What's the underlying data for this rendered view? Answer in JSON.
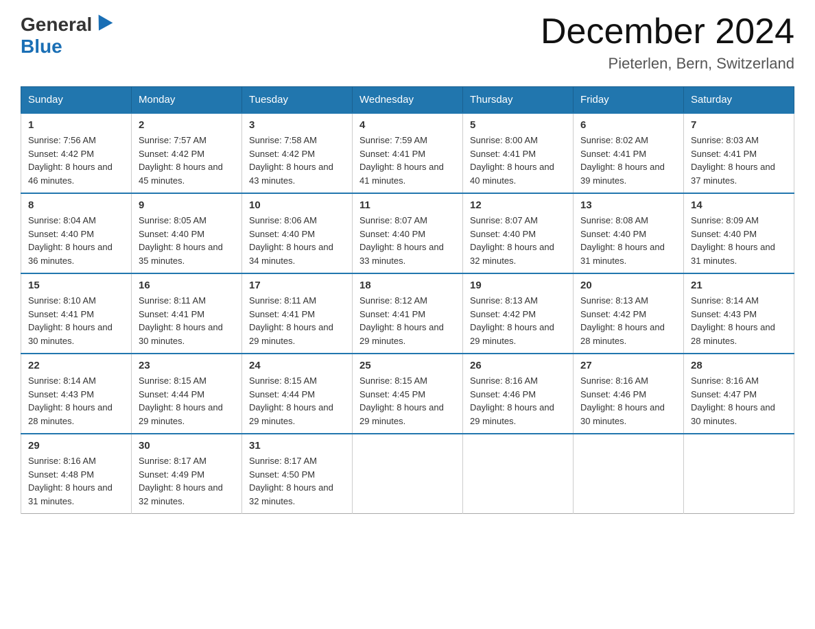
{
  "header": {
    "logo_general": "General",
    "logo_blue": "Blue",
    "month_title": "December 2024",
    "location": "Pieterlen, Bern, Switzerland"
  },
  "weekdays": [
    "Sunday",
    "Monday",
    "Tuesday",
    "Wednesday",
    "Thursday",
    "Friday",
    "Saturday"
  ],
  "weeks": [
    [
      {
        "day": "1",
        "sunrise": "7:56 AM",
        "sunset": "4:42 PM",
        "daylight": "8 hours and 46 minutes."
      },
      {
        "day": "2",
        "sunrise": "7:57 AM",
        "sunset": "4:42 PM",
        "daylight": "8 hours and 45 minutes."
      },
      {
        "day": "3",
        "sunrise": "7:58 AM",
        "sunset": "4:42 PM",
        "daylight": "8 hours and 43 minutes."
      },
      {
        "day": "4",
        "sunrise": "7:59 AM",
        "sunset": "4:41 PM",
        "daylight": "8 hours and 41 minutes."
      },
      {
        "day": "5",
        "sunrise": "8:00 AM",
        "sunset": "4:41 PM",
        "daylight": "8 hours and 40 minutes."
      },
      {
        "day": "6",
        "sunrise": "8:02 AM",
        "sunset": "4:41 PM",
        "daylight": "8 hours and 39 minutes."
      },
      {
        "day": "7",
        "sunrise": "8:03 AM",
        "sunset": "4:41 PM",
        "daylight": "8 hours and 37 minutes."
      }
    ],
    [
      {
        "day": "8",
        "sunrise": "8:04 AM",
        "sunset": "4:40 PM",
        "daylight": "8 hours and 36 minutes."
      },
      {
        "day": "9",
        "sunrise": "8:05 AM",
        "sunset": "4:40 PM",
        "daylight": "8 hours and 35 minutes."
      },
      {
        "day": "10",
        "sunrise": "8:06 AM",
        "sunset": "4:40 PM",
        "daylight": "8 hours and 34 minutes."
      },
      {
        "day": "11",
        "sunrise": "8:07 AM",
        "sunset": "4:40 PM",
        "daylight": "8 hours and 33 minutes."
      },
      {
        "day": "12",
        "sunrise": "8:07 AM",
        "sunset": "4:40 PM",
        "daylight": "8 hours and 32 minutes."
      },
      {
        "day": "13",
        "sunrise": "8:08 AM",
        "sunset": "4:40 PM",
        "daylight": "8 hours and 31 minutes."
      },
      {
        "day": "14",
        "sunrise": "8:09 AM",
        "sunset": "4:40 PM",
        "daylight": "8 hours and 31 minutes."
      }
    ],
    [
      {
        "day": "15",
        "sunrise": "8:10 AM",
        "sunset": "4:41 PM",
        "daylight": "8 hours and 30 minutes."
      },
      {
        "day": "16",
        "sunrise": "8:11 AM",
        "sunset": "4:41 PM",
        "daylight": "8 hours and 30 minutes."
      },
      {
        "day": "17",
        "sunrise": "8:11 AM",
        "sunset": "4:41 PM",
        "daylight": "8 hours and 29 minutes."
      },
      {
        "day": "18",
        "sunrise": "8:12 AM",
        "sunset": "4:41 PM",
        "daylight": "8 hours and 29 minutes."
      },
      {
        "day": "19",
        "sunrise": "8:13 AM",
        "sunset": "4:42 PM",
        "daylight": "8 hours and 29 minutes."
      },
      {
        "day": "20",
        "sunrise": "8:13 AM",
        "sunset": "4:42 PM",
        "daylight": "8 hours and 28 minutes."
      },
      {
        "day": "21",
        "sunrise": "8:14 AM",
        "sunset": "4:43 PM",
        "daylight": "8 hours and 28 minutes."
      }
    ],
    [
      {
        "day": "22",
        "sunrise": "8:14 AM",
        "sunset": "4:43 PM",
        "daylight": "8 hours and 28 minutes."
      },
      {
        "day": "23",
        "sunrise": "8:15 AM",
        "sunset": "4:44 PM",
        "daylight": "8 hours and 29 minutes."
      },
      {
        "day": "24",
        "sunrise": "8:15 AM",
        "sunset": "4:44 PM",
        "daylight": "8 hours and 29 minutes."
      },
      {
        "day": "25",
        "sunrise": "8:15 AM",
        "sunset": "4:45 PM",
        "daylight": "8 hours and 29 minutes."
      },
      {
        "day": "26",
        "sunrise": "8:16 AM",
        "sunset": "4:46 PM",
        "daylight": "8 hours and 29 minutes."
      },
      {
        "day": "27",
        "sunrise": "8:16 AM",
        "sunset": "4:46 PM",
        "daylight": "8 hours and 30 minutes."
      },
      {
        "day": "28",
        "sunrise": "8:16 AM",
        "sunset": "4:47 PM",
        "daylight": "8 hours and 30 minutes."
      }
    ],
    [
      {
        "day": "29",
        "sunrise": "8:16 AM",
        "sunset": "4:48 PM",
        "daylight": "8 hours and 31 minutes."
      },
      {
        "day": "30",
        "sunrise": "8:17 AM",
        "sunset": "4:49 PM",
        "daylight": "8 hours and 32 minutes."
      },
      {
        "day": "31",
        "sunrise": "8:17 AM",
        "sunset": "4:50 PM",
        "daylight": "8 hours and 32 minutes."
      },
      null,
      null,
      null,
      null
    ]
  ],
  "labels": {
    "sunrise": "Sunrise:",
    "sunset": "Sunset:",
    "daylight": "Daylight:"
  }
}
